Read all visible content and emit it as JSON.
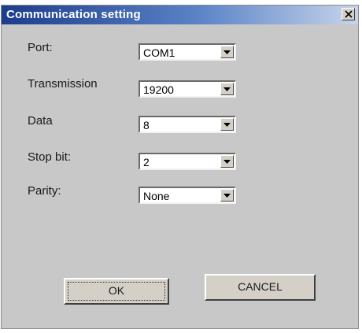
{
  "window": {
    "title": "Communication setting",
    "close_label": "×"
  },
  "fields": [
    {
      "label": "Port:",
      "value": "COM1"
    },
    {
      "label": "Transmission",
      "value": "19200"
    },
    {
      "label": "Data",
      "value": "8"
    },
    {
      "label": "Stop bit:",
      "value": "2"
    },
    {
      "label": "Parity:",
      "value": "None"
    }
  ],
  "buttons": {
    "ok_label": "OK",
    "cancel_label": "CANCEL"
  },
  "colors": {
    "titlebar_start": "#1c3c8c",
    "titlebar_end": "#c6d4ea",
    "dialog_bg": "#c8c8c8"
  },
  "icons": {
    "close": "close-icon",
    "dropdown": "chevron-down-icon"
  }
}
